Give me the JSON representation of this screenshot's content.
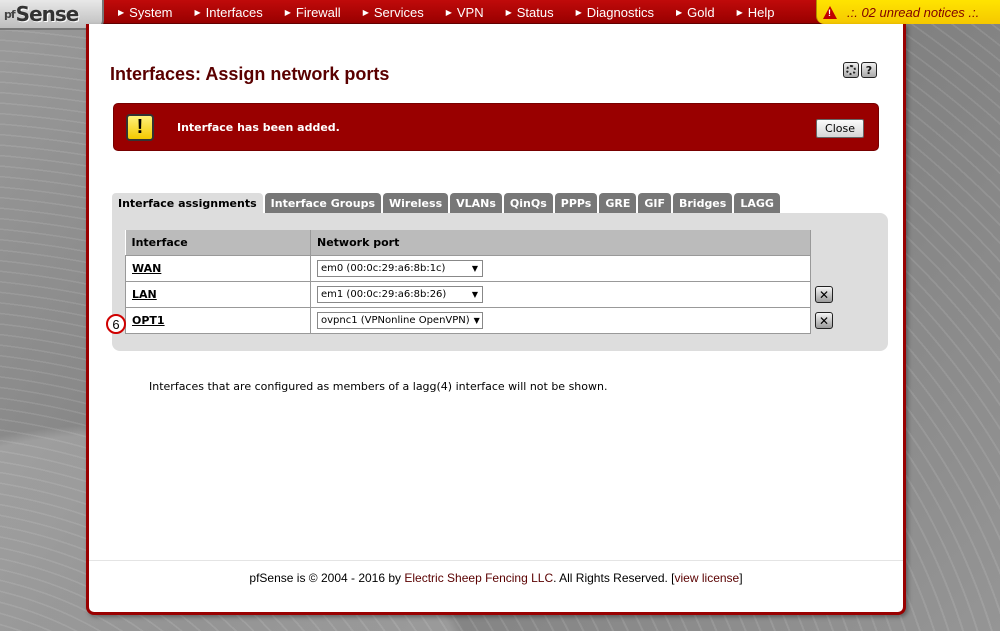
{
  "logo": {
    "prefix": "pf",
    "text": "Sense"
  },
  "menu": [
    {
      "label": "System"
    },
    {
      "label": "Interfaces"
    },
    {
      "label": "Firewall"
    },
    {
      "label": "Services"
    },
    {
      "label": "VPN"
    },
    {
      "label": "Status"
    },
    {
      "label": "Diagnostics"
    },
    {
      "label": "Gold"
    },
    {
      "label": "Help"
    }
  ],
  "notices": {
    "text": ".:. 02 unread notices .:."
  },
  "page": {
    "title": "Interfaces: Assign network ports"
  },
  "alert": {
    "message": "Interface has been added.",
    "close_label": "Close",
    "icon_glyph": "!"
  },
  "tabs": [
    {
      "label": "Interface assignments",
      "active": true
    },
    {
      "label": "Interface Groups"
    },
    {
      "label": "Wireless"
    },
    {
      "label": "VLANs"
    },
    {
      "label": "QinQs"
    },
    {
      "label": "PPPs"
    },
    {
      "label": "GRE"
    },
    {
      "label": "GIF"
    },
    {
      "label": "Bridges"
    },
    {
      "label": "LAGG"
    }
  ],
  "table": {
    "headers": [
      "Interface",
      "Network port"
    ],
    "rows": [
      {
        "interface": "WAN",
        "port": "em0 (00:0c:29:a6:8b:1c)"
      },
      {
        "interface": "LAN",
        "port": "em1 (00:0c:29:a6:8b:26)"
      },
      {
        "interface": "OPT1",
        "port": "ovpnc1 (VPNonline OpenVPN)"
      }
    ]
  },
  "step_badge": "6",
  "note": "Interfaces that are configured as members of a lagg(4) interface will not be shown.",
  "footer": {
    "prefix": "pfSense is © 2004 - 2016 by ",
    "company": "Electric Sheep Fencing LLC",
    "middle": ". All Rights Reserved. [",
    "license": "view license",
    "suffix": "]"
  },
  "icons": {
    "logo": "pfsense-logo",
    "notice": "warning-triangle-icon",
    "settings": "gear-icon",
    "help": "help-icon",
    "alert": "exclamation-icon",
    "delete": "delete-icon",
    "menu_arrow": "triangle-right-icon",
    "dropdown": "chevron-down-icon"
  },
  "colors": {
    "brand_red": "#990000",
    "title_red": "#5a0000",
    "notice_yellow": "#ffe400",
    "tab_inactive": "#777777",
    "tab_active": "#dddddd"
  }
}
